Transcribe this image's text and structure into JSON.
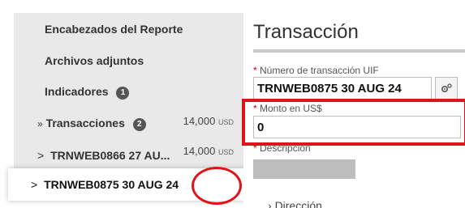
{
  "nav": {
    "items": [
      {
        "label": "Encabezados del Reporte"
      },
      {
        "label": "Archivos adjuntos"
      },
      {
        "label": "Indicadores",
        "badge": "1"
      },
      {
        "prefix": "»",
        "label": "Transacciones",
        "badge": "2",
        "amount": "14,000",
        "currency": "USD"
      },
      {
        "prefix": ">",
        "label": "TRNWEB0866 27 AU...",
        "amount": "14,000",
        "currency": "USD"
      },
      {
        "prefix": ">",
        "label": "TRNWEB0875 30 AUG 24"
      }
    ]
  },
  "panel": {
    "title": "Transacción",
    "fields": {
      "uif_label": "Número de transacción UIF",
      "uif_value": "TRNWEB0875  30 AUG 24",
      "monto_label": "Monto en US$",
      "monto_value": "0",
      "descripcion_label": "Descripción"
    },
    "cutoff_text": "Dirección"
  },
  "colors": {
    "accent_green": "#2e9e44",
    "annotation_red": "#e0131a"
  },
  "icons": {
    "settings": "gear-icon"
  }
}
